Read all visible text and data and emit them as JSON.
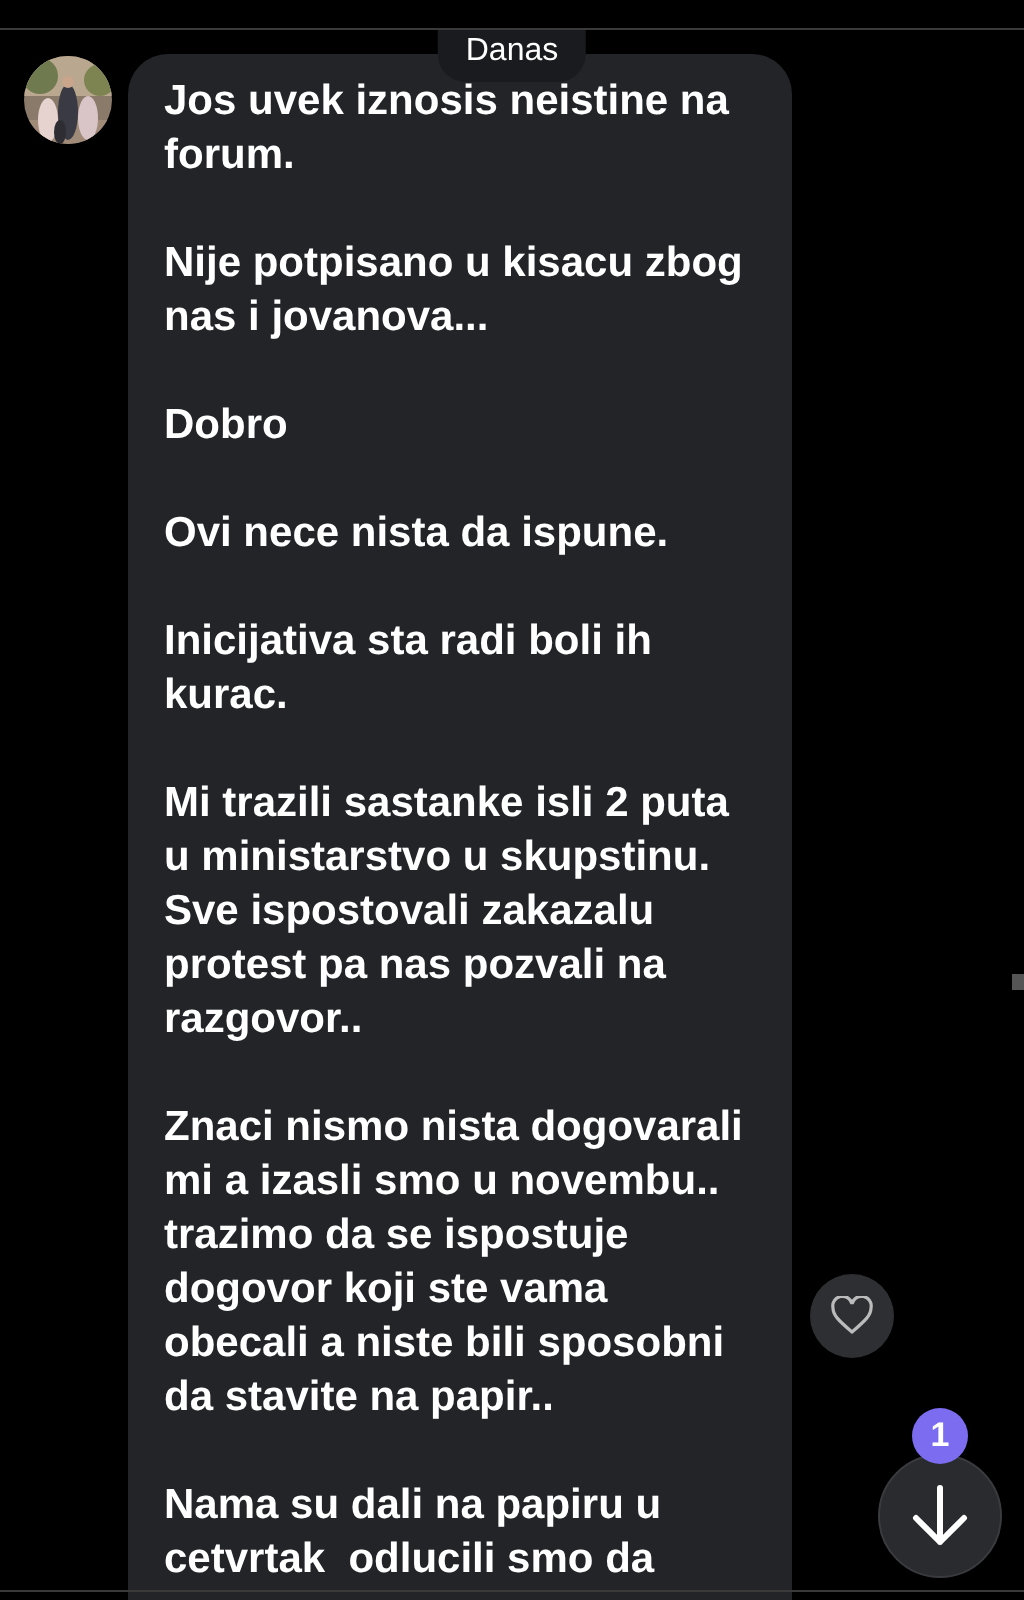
{
  "date_divider": "Danas",
  "message": {
    "kind": "received",
    "paragraphs": [
      "Jos uvek iznosis neistine na\nforum.",
      "Nije potpisano u kisacu zbog\nnas i jovanova...",
      "Dobro",
      "Ovi nece nista da ispune.",
      "Inicijativa sta radi boli ih\nkurac.",
      "Mi trazili sastanke isli 2 puta\nu ministarstvo u skupstinu.\nSve ispostovali zakazalu\nprotest pa nas pozvali na\nrazgovor..",
      "Znaci nismo nista dogovarali\nmi a izasli smo u novembu..\ntrazimo da se ispostuje\ndogovor koji ste vama\nobecali a niste bili sposobni\nda stavite na papir..",
      "Nama su dali na papiru u\ncetvrtak  odlucili smo da"
    ],
    "liked": false
  },
  "scroll_button": {
    "badge": "1"
  }
}
